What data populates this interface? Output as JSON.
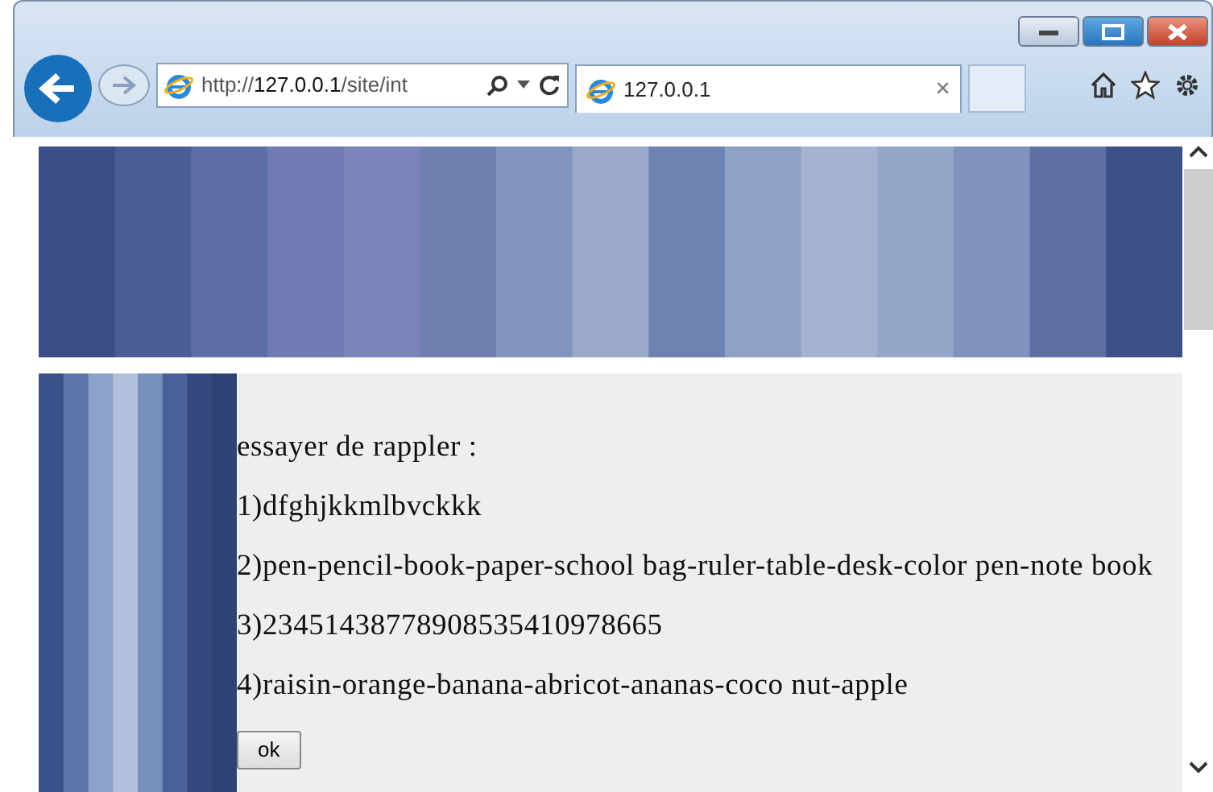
{
  "browser": {
    "address": "http://**127.0.0.1**/site/int",
    "tab": {
      "title": "127.0.0.1",
      "selected": true,
      "close": "×"
    }
  },
  "page": {
    "lines": [
      "essayer de rappler :",
      "1)dfghjkkmlbvckkk",
      "2)pen-pencil-book-paper-school bag-ruler-table-desk-color pen-note book",
      "3)23451438778908535410978665",
      "4)raisin-orange-banana-abricot-ananas-coco nut-apple"
    ],
    "button": "ok"
  }
}
